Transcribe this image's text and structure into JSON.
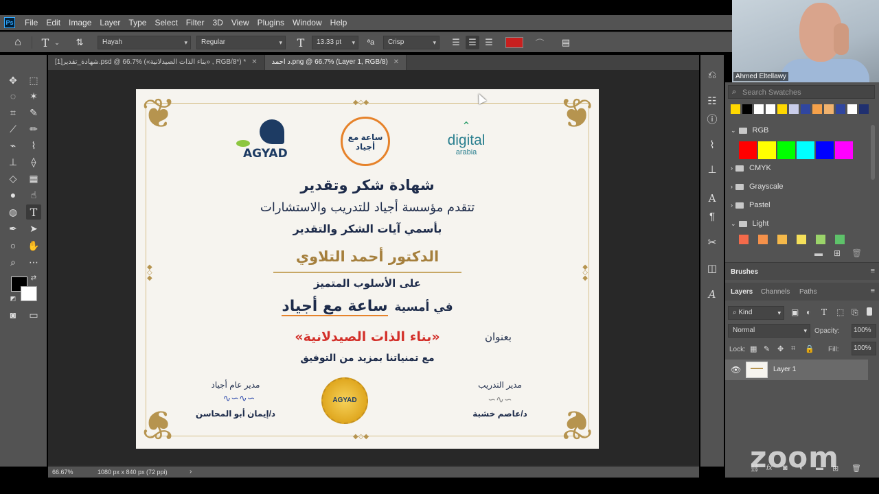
{
  "menu": {
    "app_icon": "Ps",
    "items": [
      "File",
      "Edit",
      "Image",
      "Layer",
      "Type",
      "Select",
      "Filter",
      "3D",
      "View",
      "Plugins",
      "Window",
      "Help"
    ]
  },
  "options": {
    "font_family": "Hayah",
    "font_style": "Regular",
    "font_size": "13.33 pt",
    "aa_label": "ªa",
    "anti_alias": "Crisp",
    "text_color": "#c8201f"
  },
  "tabs": [
    {
      "label": "شهادة_تقدير[1].psd @ 66.7% («بناء الذات الصيدلانية» , RGB/8*) *",
      "active": false
    },
    {
      "label": "د احمد.png @ 66.7% (Layer 1, RGB/8)",
      "active": true
    }
  ],
  "certificate": {
    "logo_left": "AGYAD",
    "logo_right_1": "digital",
    "logo_right_2": "arabia",
    "logo_center": "ساعة مع أجياد",
    "title": "شهادة شكر وتقدير",
    "line_1": "تتقدم مؤسسة أجياد للتدريب والاستشارات",
    "line_2": "بأسمي آيات الشكر والتقدير",
    "recipient": "الدكتور أحمد التلاوي",
    "line_3": "على الأسلوب المتميز",
    "line_4": "في أمسية",
    "line_4_brand": "ساعة مع أجياد",
    "titled": "بعنوان",
    "event_title": "«بناء الذات الصيدلانية»",
    "wishes": "مع تمنياتنا بمزيد من التوفيق",
    "sig_right_role": "مدير التدريب",
    "sig_right_name": "د/عاصم خشبة",
    "sig_left_role": "مدير عام أجياد",
    "sig_left_name": "د/إيمان أبو المحاسن",
    "seal_text": "AGYAD"
  },
  "status": {
    "zoom": "66.67%",
    "dimensions": "1080 px x 840 px (72 ppi)"
  },
  "swatches": {
    "search_placeholder": "Search Swatches",
    "recent": [
      "#ffd800",
      "#000000",
      "#ffffff",
      "#ffffff",
      "#ffd800",
      "#c9cdea",
      "#3046a0",
      "#f5a14a",
      "#f0b26e",
      "#3046a0",
      "#ffffff",
      "#203070"
    ],
    "groups": [
      {
        "name": "RGB",
        "expanded": true,
        "colors": [
          "#ff0000",
          "#ffff00",
          "#00ff00",
          "#00ffff",
          "#0000ff",
          "#ff00ff"
        ]
      },
      {
        "name": "CMYK",
        "expanded": false
      },
      {
        "name": "Grayscale",
        "expanded": false
      },
      {
        "name": "Pastel",
        "expanded": false
      },
      {
        "name": "Light",
        "expanded": true,
        "colors": [
          "#f46a4a",
          "#f5914a",
          "#f5b94a",
          "#f5e05a",
          "#9bd46a",
          "#5ec26a"
        ]
      }
    ]
  },
  "brushes": {
    "label": "Brushes"
  },
  "layers_panel": {
    "tabs": [
      "Layers",
      "Channels",
      "Paths"
    ],
    "filter_kind": "Kind",
    "blend_mode": "Normal",
    "opacity_label": "Opacity:",
    "opacity": "100%",
    "lock_label": "Lock:",
    "fill_label": "Fill:",
    "fill": "100%",
    "layers": [
      {
        "name": "Layer 1",
        "visible": true
      }
    ]
  },
  "webcam": {
    "participant_name": "Ahmed Eltellawy"
  },
  "zoom_watermark": "zoom"
}
